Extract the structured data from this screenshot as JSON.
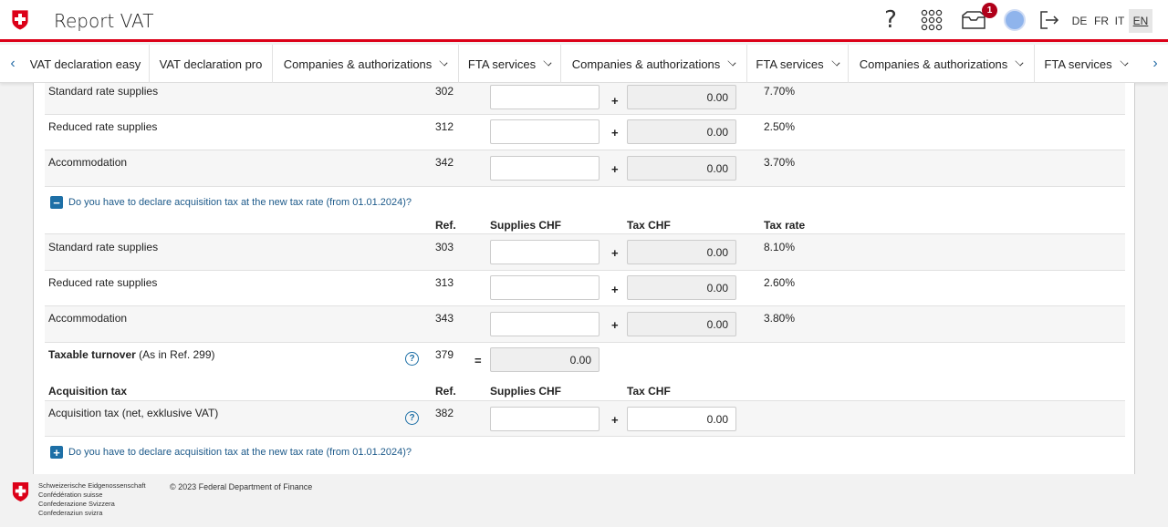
{
  "header": {
    "title": "Report VAT",
    "help_label": "?",
    "inbox_badge": "1",
    "languages": [
      "DE",
      "FR",
      "IT",
      "EN"
    ],
    "active_language": "EN",
    "icons": [
      "swiss-cross-logo",
      "help-icon",
      "apps-grid-icon",
      "inbox-icon",
      "avatar",
      "logout-icon"
    ]
  },
  "nav": {
    "prev_arrow": "‹",
    "next_arrow": "›",
    "items": [
      {
        "label": "VAT declaration easy",
        "dropdown": false
      },
      {
        "label": "VAT declaration pro",
        "dropdown": false
      },
      {
        "label": "Companies & authorizations",
        "dropdown": true
      },
      {
        "label": "FTA services",
        "dropdown": true
      },
      {
        "label": "Companies & authorizations",
        "dropdown": true
      },
      {
        "label": "FTA services",
        "dropdown": true
      },
      {
        "label": "Companies & authorizations",
        "dropdown": true
      },
      {
        "label": "FTA services",
        "dropdown": true
      }
    ]
  },
  "old_rate": {
    "rows": [
      {
        "label": "Standard rate supplies",
        "ref": "302",
        "tax": "0.00",
        "rate": "7.70%"
      },
      {
        "label": "Reduced rate supplies",
        "ref": "312",
        "tax": "0.00",
        "rate": "2.50%"
      },
      {
        "label": "Accommodation",
        "ref": "342",
        "tax": "0.00",
        "rate": "3.70%"
      }
    ]
  },
  "new_rate": {
    "toggle_label": "Do you have to declare acquisition tax at the new tax rate (from 01.01.2024)?",
    "toggle_symbol": "−",
    "headers": {
      "ref": "Ref.",
      "supplies": "Supplies CHF",
      "tax": "Tax CHF",
      "rate": "Tax rate"
    },
    "rows": [
      {
        "label": "Standard rate supplies",
        "ref": "303",
        "tax": "0.00",
        "rate": "8.10%"
      },
      {
        "label": "Reduced rate supplies",
        "ref": "313",
        "tax": "0.00",
        "rate": "2.60%"
      },
      {
        "label": "Accommodation",
        "ref": "343",
        "tax": "0.00",
        "rate": "3.80%"
      }
    ]
  },
  "taxable_turnover": {
    "label_bold": "Taxable turnover",
    "label_rest": " (As in Ref. 299)",
    "ref": "379",
    "operator": "=",
    "value": "0.00"
  },
  "operators": {
    "plus": "+"
  },
  "acquisition": {
    "title": "Acquisition tax",
    "headers": {
      "ref": "Ref.",
      "supplies": "Supplies CHF",
      "tax": "Tax CHF"
    },
    "row": {
      "label": "Acquisition tax (net, exklusive VAT)",
      "ref": "382",
      "tax": "0.00"
    },
    "toggle_label": "Do you have to declare acquisition tax at the new tax rate (from 01.01.2024)?",
    "toggle_symbol": "+"
  },
  "footer": {
    "names": [
      "Schweizerische Eidgenossenschaft",
      "Confédération suisse",
      "Confederazione Svizzera",
      "Confederaziun svizra"
    ],
    "copyright": "© 2023 Federal Department of Finance"
  },
  "colors": {
    "accent_red": "#dc0018",
    "link_blue": "#1d5a8a",
    "badge": "#b0001a"
  }
}
